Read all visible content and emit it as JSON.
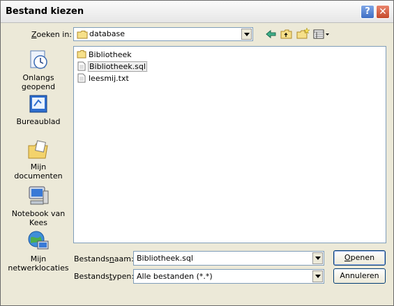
{
  "window": {
    "title": "Bestand kiezen",
    "help_label": "?",
    "close_label": "✕"
  },
  "lookin": {
    "label_pre": "",
    "label_key": "Z",
    "label_post": "oeken in:",
    "value": "database"
  },
  "toolbar": {
    "items": [
      {
        "icon": "back-arrow-icon"
      },
      {
        "icon": "folder-up-icon"
      },
      {
        "icon": "new-folder-icon"
      },
      {
        "icon": "view-menu-icon"
      }
    ]
  },
  "places": [
    {
      "name": "recent",
      "icon": "recent-documents-icon",
      "label": "Onlangs geopend"
    },
    {
      "name": "desktop",
      "icon": "desktop-icon",
      "label": "Bureaublad"
    },
    {
      "name": "my-documents",
      "icon": "my-documents-icon",
      "label": "Mijn documenten"
    },
    {
      "name": "computer",
      "icon": "computer-icon",
      "label": "Notebook van Kees"
    },
    {
      "name": "network",
      "icon": "network-places-icon",
      "label": "Mijn netwerklocaties"
    }
  ],
  "files": [
    {
      "name": "Bibliotheek",
      "type": "folder",
      "selected": false
    },
    {
      "name": "Bibliotheek.sql",
      "type": "file",
      "selected": true
    },
    {
      "name": "leesmij.txt",
      "type": "file",
      "selected": false
    }
  ],
  "filename": {
    "label_pre": "Bestands",
    "label_key": "n",
    "label_post": "aam:",
    "value": "Bibliotheek.sql"
  },
  "filetype": {
    "label_pre": "Bestands",
    "label_key": "t",
    "label_post": "ypen:",
    "value": "Alle bestanden (*.*)"
  },
  "buttons": {
    "open_key": "O",
    "open_rest": "penen",
    "cancel": "Annuleren"
  }
}
